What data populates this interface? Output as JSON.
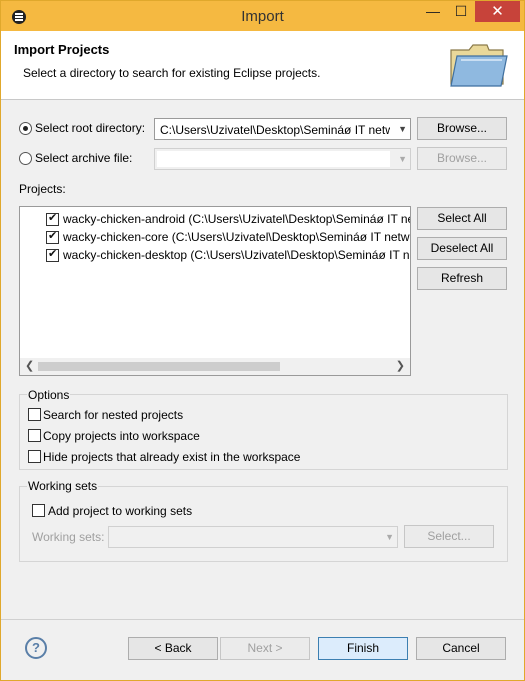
{
  "window": {
    "title": "Import",
    "minimize": "—",
    "maximize": "☐",
    "close": "✕"
  },
  "header": {
    "title": "Import Projects",
    "description": "Select a directory to search for existing Eclipse projects."
  },
  "source": {
    "root_label": "Select root directory:",
    "root_value": "C:\\Users\\Uzivatel\\Desktop\\Semináø IT netw",
    "root_selected": true,
    "archive_label": "Select archive file:",
    "archive_value": "",
    "browse_label": "Browse...",
    "browse_disabled_label": "Browse..."
  },
  "projects": {
    "label": "Projects:",
    "items": [
      {
        "checked": true,
        "text": "wacky-chicken-android (C:\\Users\\Uzivatel\\Desktop\\Semináø IT ne"
      },
      {
        "checked": true,
        "text": "wacky-chicken-core (C:\\Users\\Uzivatel\\Desktop\\Semináø IT netw"
      },
      {
        "checked": true,
        "text": "wacky-chicken-desktop (C:\\Users\\Uzivatel\\Desktop\\Semináø IT ne"
      }
    ],
    "select_all": "Select All",
    "deselect_all": "Deselect All",
    "refresh": "Refresh"
  },
  "options": {
    "label": "Options",
    "nested": "Search for nested projects",
    "copy": "Copy projects into workspace",
    "hide": "Hide projects that already exist in the workspace"
  },
  "working_sets": {
    "label": "Working sets",
    "add": "Add project to working sets",
    "sets_label": "Working sets:",
    "select_button": "Select..."
  },
  "footer": {
    "help": "?",
    "back": "< Back",
    "next": "Next >",
    "finish": "Finish",
    "cancel": "Cancel"
  }
}
